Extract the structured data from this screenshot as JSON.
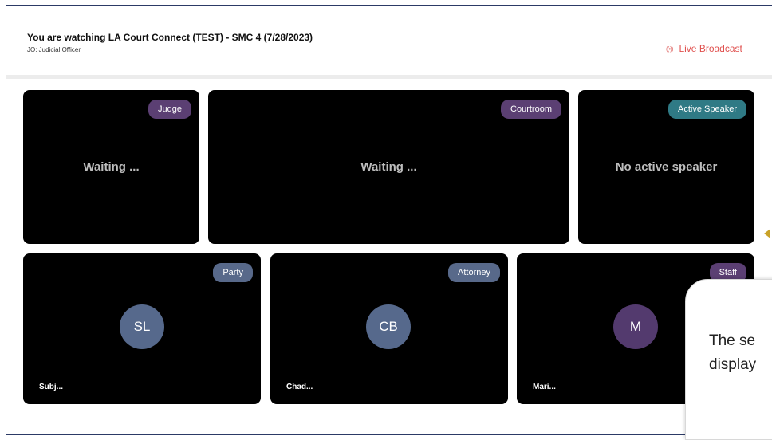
{
  "header": {
    "title": "You are watching LA Court Connect (TEST) - SMC 4 (7/28/2023)",
    "subtitle": "JO: Judicial Officer",
    "live_icon": "((•))",
    "live_label": "Live Broadcast"
  },
  "top_tiles": [
    {
      "badge": "Judge",
      "status": "Waiting ..."
    },
    {
      "badge": "Courtroom",
      "status": "Waiting ..."
    },
    {
      "badge": "Active Speaker",
      "status": "No active speaker"
    }
  ],
  "participants": [
    {
      "badge": "Party",
      "initials": "SL",
      "name": "Subj..."
    },
    {
      "badge": "Attorney",
      "initials": "CB",
      "name": "Chad..."
    },
    {
      "badge": "Staff",
      "initials": "M",
      "name": "Mari..."
    }
  ],
  "callout": {
    "line1": "The se",
    "line2": "display"
  },
  "colors": {
    "live": "#e0514f",
    "badge_purple": "#5b3f73",
    "badge_teal": "#2f7a85",
    "badge_slate": "#58698a",
    "tile_bg": "#000000"
  }
}
